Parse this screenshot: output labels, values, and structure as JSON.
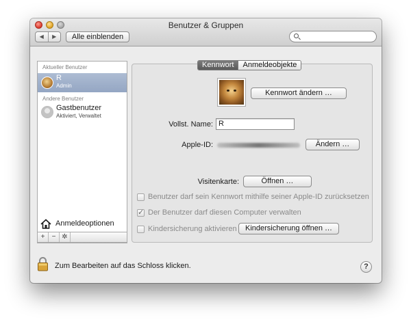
{
  "window": {
    "title": "Benutzer & Gruppen",
    "nav_back": "◀",
    "nav_forward": "▶",
    "show_all_label": "Alle einblenden",
    "search_placeholder": ""
  },
  "sidebar": {
    "current_header": "Aktueller Benutzer",
    "current_user": {
      "name": "R",
      "role": "Admin"
    },
    "other_header": "Andere Benutzer",
    "other_users": [
      {
        "name": "Gastbenutzer",
        "status": "Aktiviert, Verwaltet"
      }
    ],
    "login_options_label": "Anmeldeoptionen",
    "tools": {
      "add": "+",
      "remove": "−",
      "action": "✲"
    }
  },
  "panel": {
    "tabs": [
      {
        "label": "Kennwort",
        "active": true
      },
      {
        "label": "Anmeldeobjekte",
        "active": false
      }
    ],
    "change_password_label": "Kennwort ändern …",
    "full_name_label": "Vollst. Name:",
    "full_name_value": "R",
    "apple_id_label": "Apple-ID:",
    "apple_id_change_label": "Ändern …",
    "contact_card_label": "Visitenkarte:",
    "contact_open_label": "Öffnen …",
    "options": [
      {
        "label": "Benutzer darf sein Kennwort mithilfe seiner Apple-ID zurücksetzen",
        "checked": false,
        "enabled": false
      },
      {
        "label": "Der Benutzer darf diesen Computer verwalten",
        "checked": true,
        "enabled": false
      },
      {
        "label": "Kindersicherung aktivieren",
        "checked": false,
        "enabled": false
      }
    ],
    "parental_controls_open_label": "Kindersicherung öffnen …"
  },
  "footer": {
    "lock_text": "Zum Bearbeiten auf das Schloss klicken.",
    "help_label": "?"
  },
  "colors": {
    "selection": "#9fb0cc",
    "tab_active": "#6a6a6a",
    "window_bg": "#ececec"
  }
}
